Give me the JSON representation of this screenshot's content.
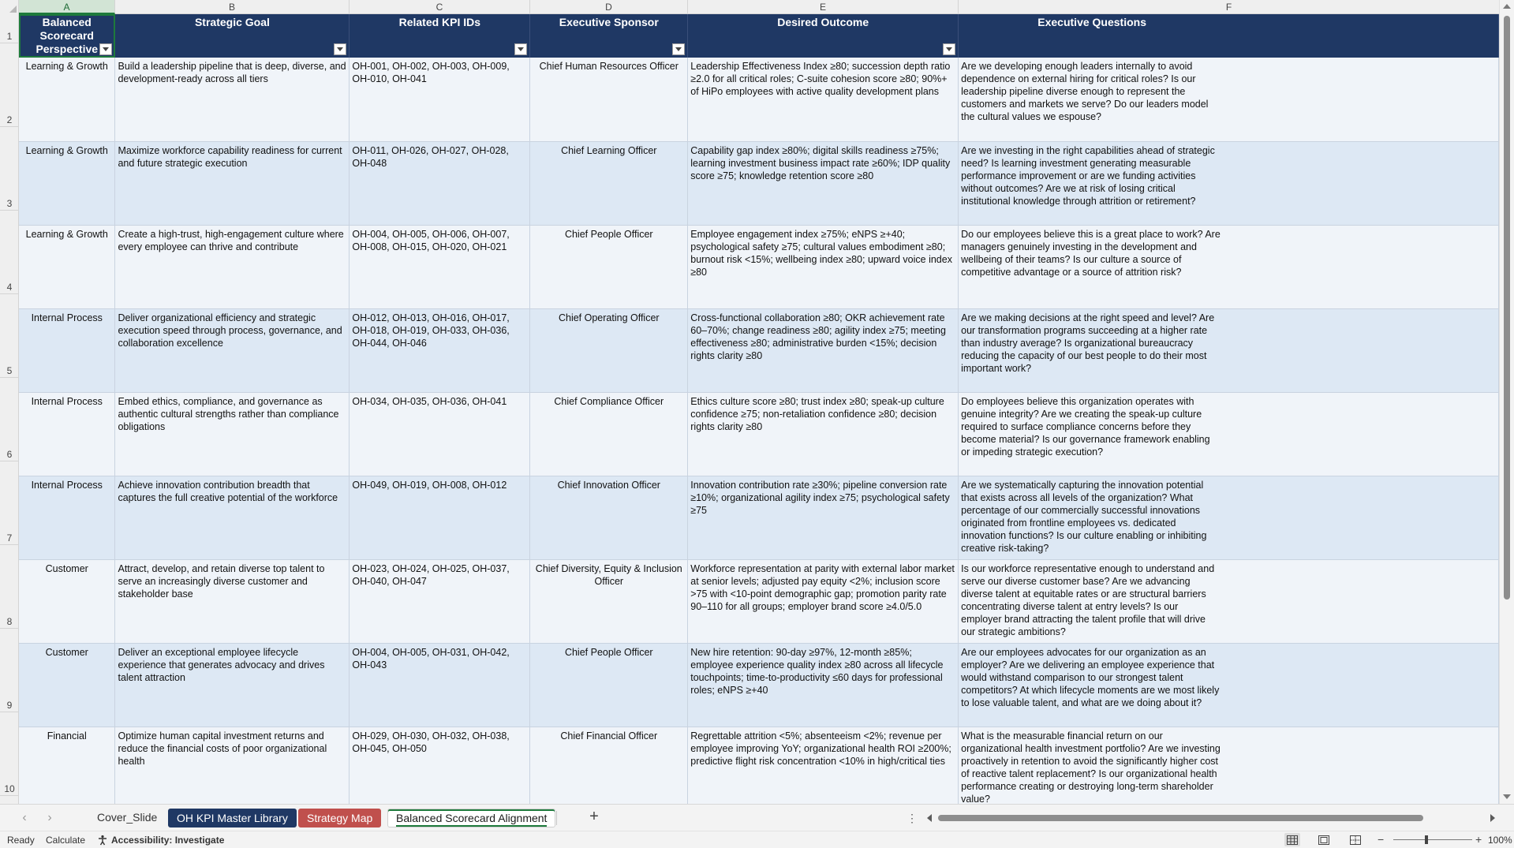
{
  "columns": [
    "A",
    "B",
    "C",
    "D",
    "E",
    "F"
  ],
  "headers": [
    "Balanced Scorecard Perspective",
    "Strategic Goal",
    "Related KPI IDs",
    "Executive Sponsor",
    "Desired Outcome",
    "Executive Questions"
  ],
  "row_numbers": [
    "1",
    "2",
    "3",
    "4",
    "5",
    "6",
    "7",
    "8",
    "9",
    "10"
  ],
  "rows": [
    {
      "perspective": "Learning & Growth",
      "goal": "Build a leadership pipeline that is deep, diverse, and development-ready across all tiers",
      "kpis": "OH-001, OH-002, OH-003, OH-009, OH-010, OH-041",
      "sponsor": "Chief Human Resources Officer",
      "outcome": "Leadership Effectiveness Index ≥80; succession depth ratio ≥2.0 for all critical roles; C-suite cohesion score ≥80; 90%+ of HiPo employees with active quality development plans",
      "questions": "Are we developing enough leaders internally to avoid dependence on external hiring for critical roles? Is our leadership pipeline diverse enough to represent the customers and markets we serve? Do our leaders model the cultural values we espouse?"
    },
    {
      "perspective": "Learning & Growth",
      "goal": "Maximize workforce capability readiness for current and future strategic execution",
      "kpis": "OH-011, OH-026, OH-027, OH-028, OH-048",
      "sponsor": "Chief Learning Officer",
      "outcome": "Capability gap index ≥80%; digital skills readiness ≥75%; learning investment business impact rate ≥60%; IDP quality score ≥75; knowledge retention score ≥80",
      "questions": "Are we investing in the right capabilities ahead of strategic need? Is learning investment generating measurable performance improvement or are we funding activities without outcomes? Are we at risk of losing critical institutional knowledge through attrition or retirement?"
    },
    {
      "perspective": "Learning & Growth",
      "goal": "Create a high-trust, high-engagement culture where every employee can thrive and contribute",
      "kpis": "OH-004, OH-005, OH-006, OH-007, OH-008, OH-015, OH-020, OH-021",
      "sponsor": "Chief People Officer",
      "outcome": "Employee engagement index ≥75%; eNPS ≥+40; psychological safety ≥75; cultural values embodiment ≥80; burnout risk <15%; wellbeing index ≥80; upward voice index ≥80",
      "questions": "Do our employees believe this is a great place to work? Are managers genuinely investing in the development and wellbeing of their teams? Is our culture a source of competitive advantage or a source of attrition risk?"
    },
    {
      "perspective": "Internal Process",
      "goal": "Deliver organizational efficiency and strategic execution speed through process, governance, and collaboration excellence",
      "kpis": "OH-012, OH-013, OH-016, OH-017, OH-018, OH-019, OH-033, OH-036, OH-044, OH-046",
      "sponsor": "Chief Operating Officer",
      "outcome": "Cross-functional collaboration ≥80; OKR achievement rate 60–70%; change readiness ≥80; agility index ≥75; meeting effectiveness ≥80; administrative burden <15%; decision rights clarity ≥80",
      "questions": "Are we making decisions at the right speed and level? Are our transformation programs succeeding at a higher rate than industry average? Is organizational bureaucracy reducing the capacity of our best people to do their most important work?"
    },
    {
      "perspective": "Internal Process",
      "goal": "Embed ethics, compliance, and governance as authentic cultural strengths rather than compliance obligations",
      "kpis": "OH-034, OH-035, OH-036, OH-041",
      "sponsor": "Chief Compliance Officer",
      "outcome": "Ethics culture score ≥80; trust index ≥80; speak-up culture confidence ≥75; non-retaliation confidence ≥80; decision rights clarity ≥80",
      "questions": "Do employees believe this organization operates with genuine integrity? Are we creating the speak-up culture required to surface compliance concerns before they become material? Is our governance framework enabling or impeding strategic execution?"
    },
    {
      "perspective": "Internal Process",
      "goal": "Achieve innovation contribution breadth that captures the full creative potential of the workforce",
      "kpis": "OH-049, OH-019, OH-008, OH-012",
      "sponsor": "Chief Innovation Officer",
      "outcome": "Innovation contribution rate ≥30%; pipeline conversion rate ≥10%; organizational agility index ≥75; psychological safety ≥75",
      "questions": "Are we systematically capturing the innovation potential that exists across all levels of the organization? What percentage of our commercially successful innovations originated from frontline employees vs. dedicated innovation functions? Is our culture enabling or inhibiting creative risk-taking?"
    },
    {
      "perspective": "Customer",
      "goal": "Attract, develop, and retain diverse top talent to serve an increasingly diverse customer and stakeholder base",
      "kpis": "OH-023, OH-024, OH-025, OH-037, OH-040, OH-047",
      "sponsor": "Chief Diversity, Equity & Inclusion Officer",
      "outcome": "Workforce representation at parity with external labor market at senior levels; adjusted pay equity <2%; inclusion score >75 with <10-point demographic gap; promotion parity rate 90–110 for all groups; employer brand score ≥4.0/5.0",
      "questions": "Is our workforce representative enough to understand and serve our diverse customer base? Are we advancing diverse talent at equitable rates or are structural barriers concentrating diverse talent at entry levels? Is our employer brand attracting the talent profile that will drive our strategic ambitions?"
    },
    {
      "perspective": "Customer",
      "goal": "Deliver an exceptional employee lifecycle experience that generates advocacy and drives talent attraction",
      "kpis": "OH-004, OH-005, OH-031, OH-042, OH-043",
      "sponsor": "Chief People Officer",
      "outcome": "New hire retention: 90-day ≥97%, 12-month ≥85%; employee experience quality index ≥80 across all lifecycle touchpoints; time-to-productivity ≤60 days for professional roles; eNPS ≥+40",
      "questions": "Are our employees advocates for our organization as an employer? Are we delivering an employee experience that would withstand comparison to our strongest talent competitors? At which lifecycle moments are we most likely to lose valuable talent, and what are we doing about it?"
    },
    {
      "perspective": "Financial",
      "goal": "Optimize human capital investment returns and reduce the financial costs of poor organizational health",
      "kpis": "OH-029, OH-030, OH-032, OH-038, OH-045, OH-050",
      "sponsor": "Chief Financial Officer",
      "outcome": "Regrettable attrition <5%; absenteeism <2%; revenue per employee improving YoY; organizational health ROI ≥200%; predictive flight risk concentration <10% in high/critical ties",
      "questions": "What is the measurable financial return on our organizational health investment portfolio? Are we investing proactively in retention to avoid the significantly higher cost of reactive talent replacement? Is our organizational health performance creating or destroying long-term shareholder value?"
    }
  ],
  "sheet_tabs": [
    "Cover_Slide",
    "OH KPI Master Library",
    "Strategy Map",
    "Balanced Scorecard Alignment"
  ],
  "active_tab": "Balanced Scorecard Alignment",
  "status": {
    "ready": "Ready",
    "calculate": "Calculate",
    "accessibility": "Accessibility: Investigate",
    "zoom": "100%"
  },
  "colors": {
    "header_bg": "#1f3864",
    "row_odd": "#f0f4f9",
    "row_even": "#dde8f4",
    "tab_navy": "#1f3864",
    "tab_red": "#c0504d",
    "select_green": "#1e7a3c"
  },
  "icons": [
    "filter-dropdown-icon",
    "scroll-left-icon",
    "scroll-right-icon",
    "add-sheet-icon",
    "more-icon",
    "accessibility-icon",
    "normal-view-icon",
    "page-layout-icon",
    "page-break-icon",
    "zoom-out-icon",
    "zoom-in-icon"
  ]
}
